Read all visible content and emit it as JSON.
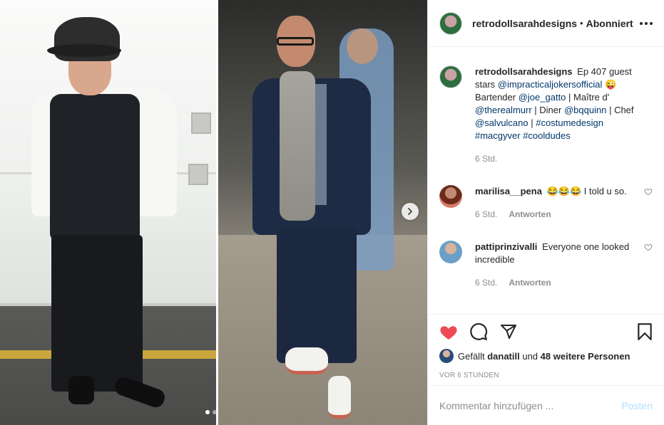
{
  "header": {
    "username": "retrodollsarahdesigns",
    "separator": "•",
    "follow_status": "Abonniert"
  },
  "media": {
    "carousel_dots": 2,
    "active_dot": 0
  },
  "caption": {
    "username": "retrodollsarahdesigns",
    "text_1": "Ep 407 guest stars",
    "mention_1": "@impracticaljokersofficial",
    "emoji_1": "😜",
    "text_2": "Bartender",
    "mention_2": "@joe_gatto",
    "text_3": "| Maître d'",
    "mention_3": "@therealmurr",
    "text_4": "| Diner",
    "mention_4": "@bqquinn",
    "text_5": "| Chef",
    "mention_5": "@salvulcano",
    "text_6": "|",
    "tag_1": "#costumedesign",
    "tag_2": "#macgyver",
    "tag_3": "#cooldudes",
    "time": "6 Std."
  },
  "comments": [
    {
      "username": "marilisa__pena",
      "text": "😂😂😂 I told u so.",
      "time": "6 Std.",
      "reply_label": "Antworten"
    },
    {
      "username": "pattiprinzivalli",
      "text": "Everyone one looked incredible",
      "time": "6 Std.",
      "reply_label": "Antworten"
    }
  ],
  "likes": {
    "prefix": "Gefällt",
    "user": "danatill",
    "middle": "und",
    "others": "48 weitere Personen"
  },
  "post_time": "VOR 6 STUNDEN",
  "comment_box": {
    "placeholder": "Kommentar hinzufügen ...",
    "post_label": "Posten"
  },
  "colors": {
    "like_red": "#ed4956",
    "mention_blue": "#00376b",
    "post_disabled": "#b2dffc"
  },
  "icons": [
    "more-icon",
    "heart-icon",
    "comment-icon",
    "share-icon",
    "bookmark-icon",
    "chevron-right-icon"
  ]
}
